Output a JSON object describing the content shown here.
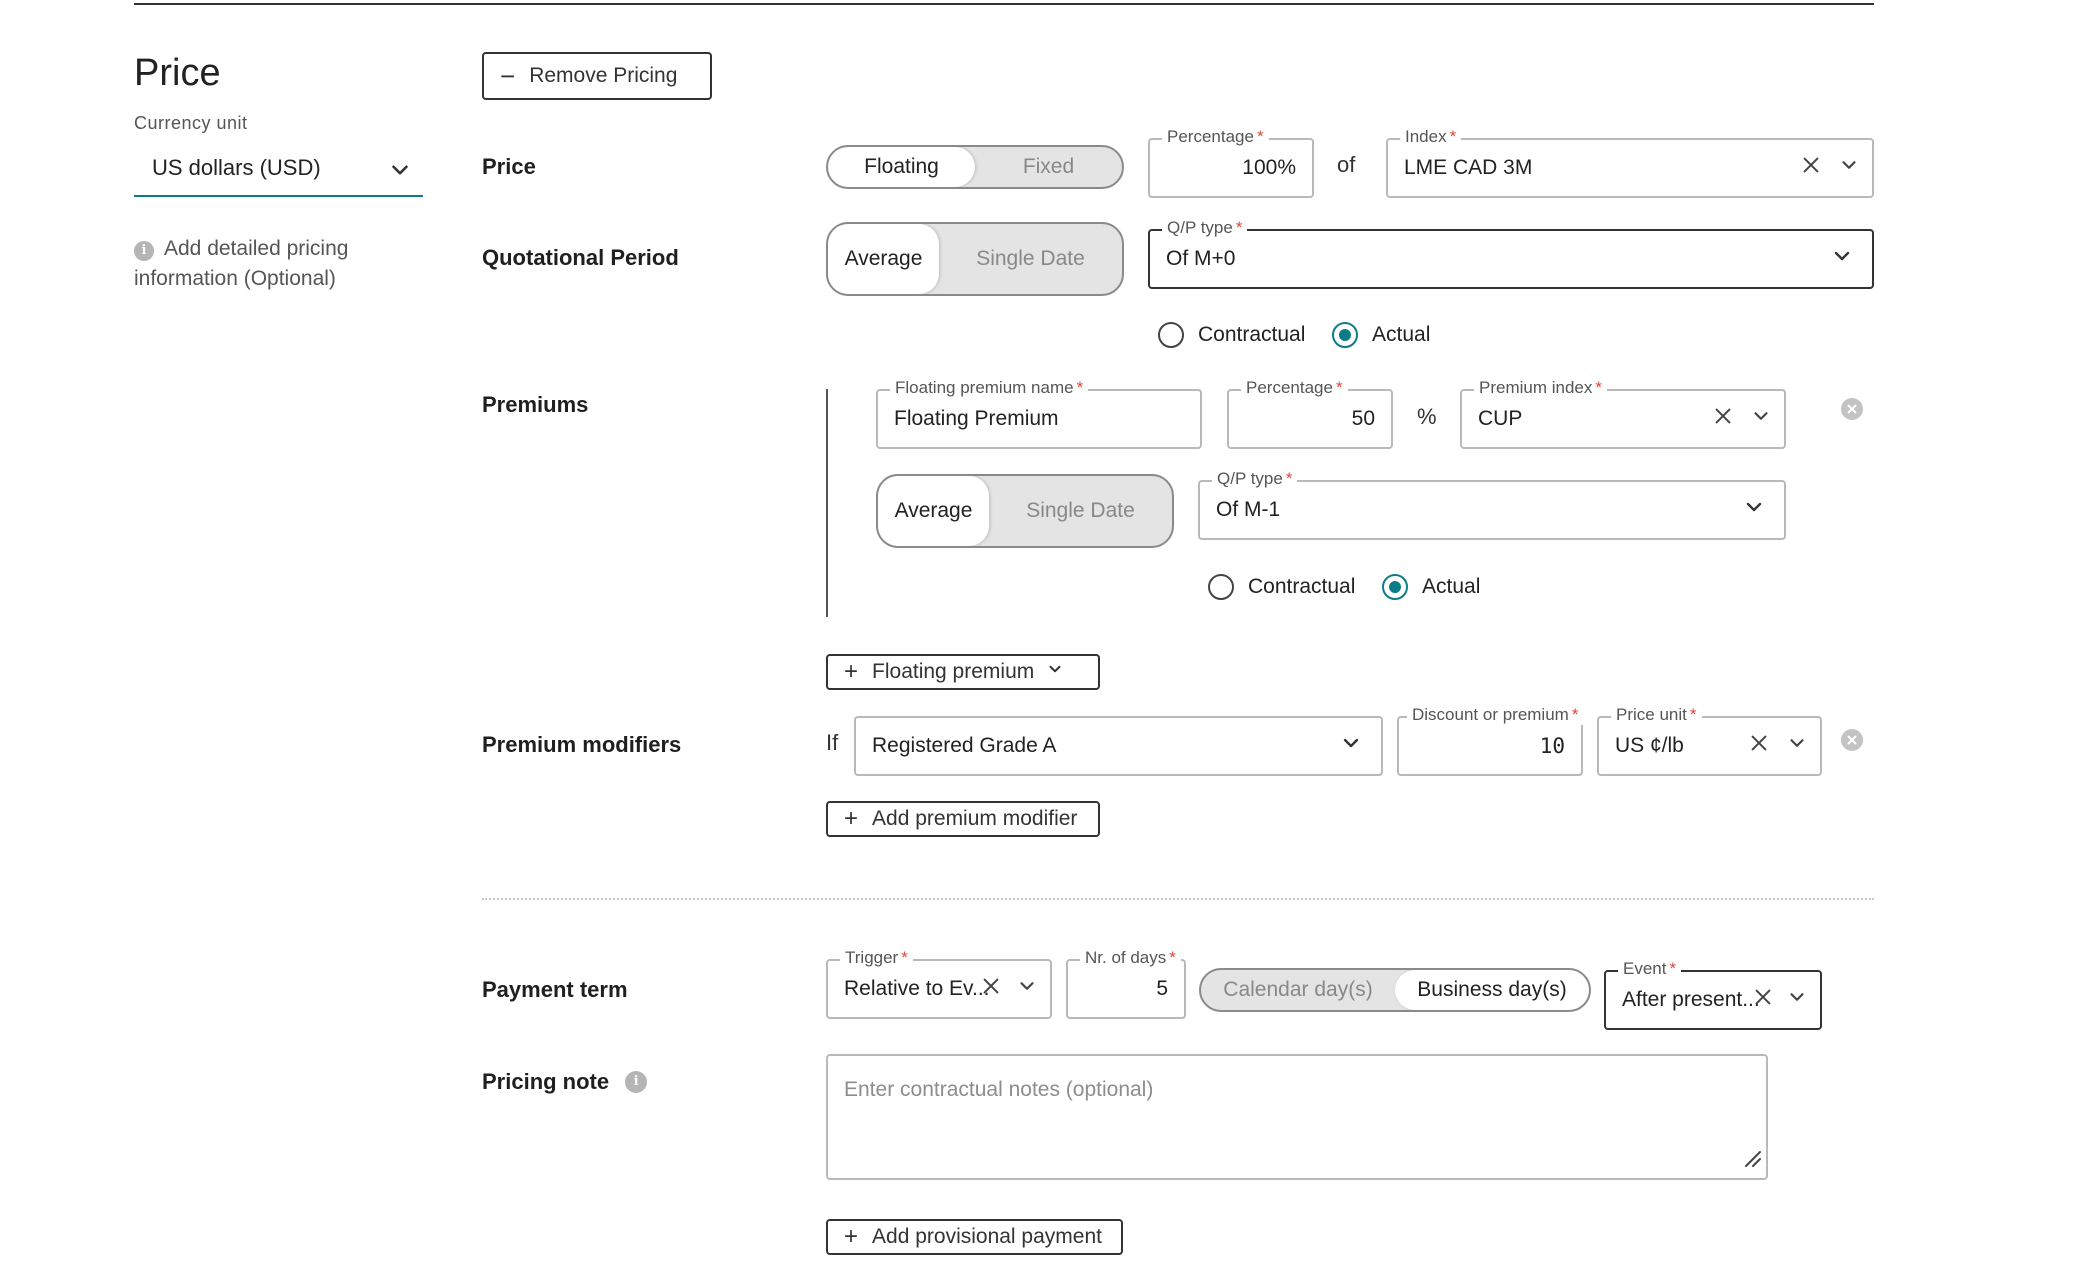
{
  "sidebar": {
    "title": "Price",
    "currency_label": "Currency unit",
    "currency_value": "US dollars (USD)",
    "info_text": "Add detailed pricing information (Optional)"
  },
  "actions": {
    "remove_pricing": "Remove Pricing",
    "floating_premium": "Floating premium",
    "add_premium_modifier": "Add premium modifier",
    "add_provisional_payment": "Add provisional payment"
  },
  "price_row": {
    "label": "Price",
    "toggle": [
      "Floating",
      "Fixed"
    ],
    "toggle_selected": "Floating",
    "percentage_label": "Percentage",
    "percentage_value": "100%",
    "of_text": "of",
    "index_label": "Index",
    "index_value": "LME CAD 3M"
  },
  "qp_row": {
    "label": "Quotational Period",
    "toggle": [
      "Average",
      "Single Date"
    ],
    "toggle_selected": "Average",
    "qp_type_label": "Q/P type",
    "qp_type_value": "Of M+0",
    "radios": [
      "Contractual",
      "Actual"
    ],
    "radio_selected": "Actual"
  },
  "premiums": {
    "label": "Premiums",
    "name_label": "Floating premium name",
    "name_value": "Floating Premium",
    "percentage_label": "Percentage",
    "percentage_value": "50",
    "percent_sign": "%",
    "index_label": "Premium index",
    "index_value": "CUP",
    "toggle": [
      "Average",
      "Single Date"
    ],
    "toggle_selected": "Average",
    "qp_type_label": "Q/P type",
    "qp_type_value": "Of M-1",
    "radios": [
      "Contractual",
      "Actual"
    ],
    "radio_selected": "Actual"
  },
  "modifiers": {
    "label": "Premium modifiers",
    "if_text": "If",
    "condition_value": "Registered Grade A",
    "discount_label": "Discount or premium",
    "discount_value": "10",
    "price_unit_label": "Price unit",
    "price_unit_value": "US ¢/lb"
  },
  "payment_term": {
    "label": "Payment term",
    "trigger_label": "Trigger",
    "trigger_value": "Relative to Ev...",
    "days_label": "Nr. of days",
    "days_value": "5",
    "day_toggle": [
      "Calendar day(s)",
      "Business day(s)"
    ],
    "day_toggle_selected": "Business day(s)",
    "event_label": "Event",
    "event_value": "After present..."
  },
  "pricing_note": {
    "label": "Pricing note",
    "placeholder": "Enter contractual notes (optional)"
  },
  "colors": {
    "accent": "#0e7c86",
    "required": "#e0453a"
  }
}
